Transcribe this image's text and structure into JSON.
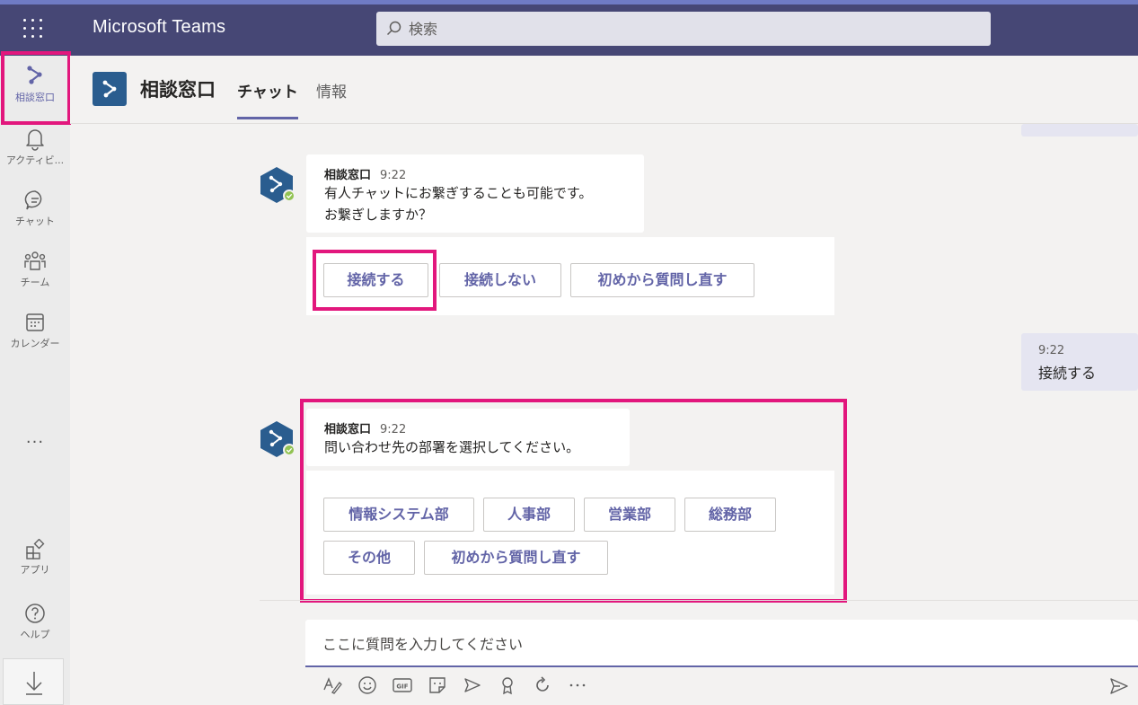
{
  "app": {
    "title": "Microsoft Teams"
  },
  "search": {
    "placeholder": "検索"
  },
  "rail": {
    "items": [
      {
        "label": "相談窓口",
        "icon": "bot-icon"
      },
      {
        "label": "アクティビ...",
        "icon": "bell-icon"
      },
      {
        "label": "チャット",
        "icon": "chat-icon"
      },
      {
        "label": "チーム",
        "icon": "teams-icon"
      },
      {
        "label": "カレンダー",
        "icon": "calendar-icon"
      }
    ],
    "more": "···",
    "apps_label": "アプリ",
    "help_label": "ヘルプ"
  },
  "header": {
    "channel_name": "相談窓口",
    "tabs": [
      {
        "label": "チャット"
      },
      {
        "label": "情報"
      }
    ]
  },
  "messages": [
    {
      "author": "相談窓口",
      "time": "9:22",
      "lines": [
        "有人チャットにお繋ぎすることも可能です。",
        "お繋ぎしますか？"
      ],
      "buttons": [
        "接続する",
        "接続しない",
        "初めから質問し直す"
      ]
    },
    {
      "own": true,
      "time": "9:22",
      "text": "接続する"
    },
    {
      "author": "相談窓口",
      "time": "9:22",
      "lines": [
        "問い合わせ先の部署を選択してください。"
      ],
      "buttons": [
        "情報システム部",
        "人事部",
        "営業部",
        "総務部",
        "その他",
        "初めから質問し直す"
      ]
    }
  ],
  "compose": {
    "placeholder": "ここに質問を入力してください"
  },
  "colors": {
    "topbar": "#464775",
    "accent": "#6264a7",
    "highlight": "#e2177d",
    "bot_avatar": "#2a5d8f"
  }
}
